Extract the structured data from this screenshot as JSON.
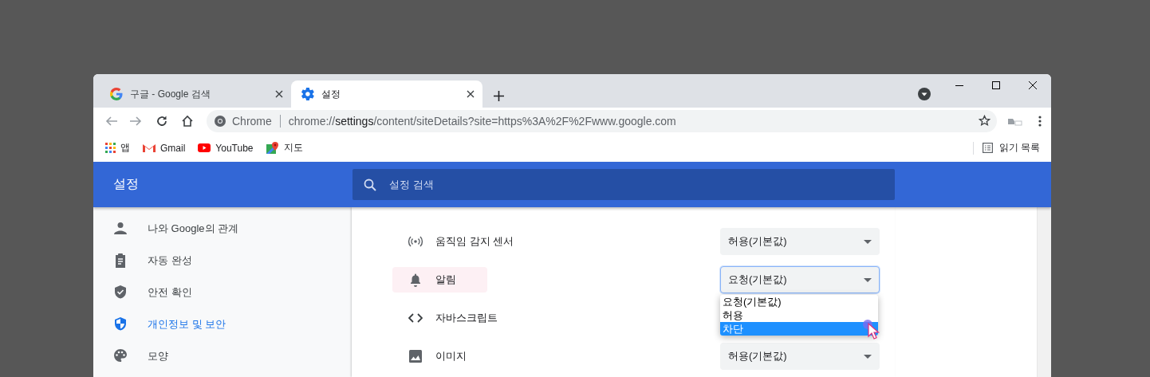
{
  "tabs": [
    {
      "title": "구글 - Google 검색",
      "selected": false
    },
    {
      "title": "설정",
      "selected": true
    }
  ],
  "omnibox": {
    "origin": "Chrome",
    "url": "chrome://**settings**/content/siteDetails?site=https%3A%2F%2Fwww.google.com"
  },
  "bookmarks": [
    {
      "label": "앱"
    },
    {
      "label": "Gmail"
    },
    {
      "label": "YouTube"
    },
    {
      "label": "지도"
    }
  ],
  "reading_list": "읽기 목록",
  "header": {
    "title": "설정",
    "search_placeholder": "설정 검색"
  },
  "sidebar": {
    "items": [
      {
        "label": "나와 Google의 관계",
        "selected": false
      },
      {
        "label": "자동 완성",
        "selected": false
      },
      {
        "label": "안전 확인",
        "selected": false
      },
      {
        "label": "개인정보 및 보안",
        "selected": true
      },
      {
        "label": "모양",
        "selected": false
      }
    ]
  },
  "permissions": [
    {
      "label": "움직임 감지 센서",
      "value": "허용(기본값)",
      "highlighted": false,
      "focused": false
    },
    {
      "label": "알림",
      "value": "요청(기본값)",
      "highlighted": true,
      "focused": true
    },
    {
      "label": "자바스크립트",
      "highlighted": false,
      "focused": false
    },
    {
      "label": "이미지",
      "value": "허용(기본값)",
      "highlighted": false,
      "focused": false
    }
  ],
  "dropdown": {
    "options": [
      {
        "label": "요청(기본값)",
        "selected": false
      },
      {
        "label": "허용",
        "selected": false
      },
      {
        "label": "차단",
        "selected": true
      }
    ]
  }
}
